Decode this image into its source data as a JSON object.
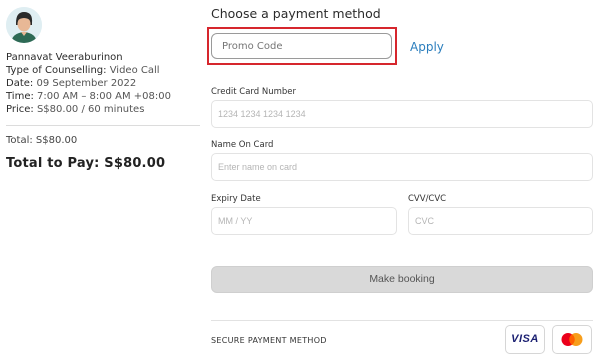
{
  "booking": {
    "counsellor_name": "Pannavat Veeraburinon",
    "type_label": "Type of Counselling:",
    "type_value": "Video Call",
    "date_label": "Date:",
    "date_value": "09 September 2022",
    "time_label": "Time:",
    "time_value": "7:00 AM – 8:00 AM +08:00",
    "price_label": "Price:",
    "price_value": "S$80.00 / 60 minutes",
    "total_text": "Total: S$80.00",
    "total_to_pay": "Total to Pay: S$80.00"
  },
  "payment": {
    "heading": "Choose a payment method",
    "promo_placeholder": "Promo Code",
    "apply_label": "Apply",
    "card_number_label": "Credit Card Number",
    "card_number_placeholder": "1234 1234 1234 1234",
    "name_label": "Name On Card",
    "name_placeholder": "Enter name on card",
    "expiry_label": "Expiry Date",
    "expiry_placeholder": "MM / YY",
    "cvv_label": "CVV/CVC",
    "cvv_placeholder": "CVC",
    "book_button": "Make booking",
    "secure_text": "SECURE PAYMENT METHOD",
    "visa_text": "VISA"
  },
  "icons": {
    "avatar": "counsellor-avatar",
    "visa": "visa-card-icon",
    "mastercard": "mastercard-icon"
  },
  "colors": {
    "apply_link": "#2b7ebd",
    "highlight": "#d6262d",
    "button_disabled": "#d9d9d9"
  }
}
